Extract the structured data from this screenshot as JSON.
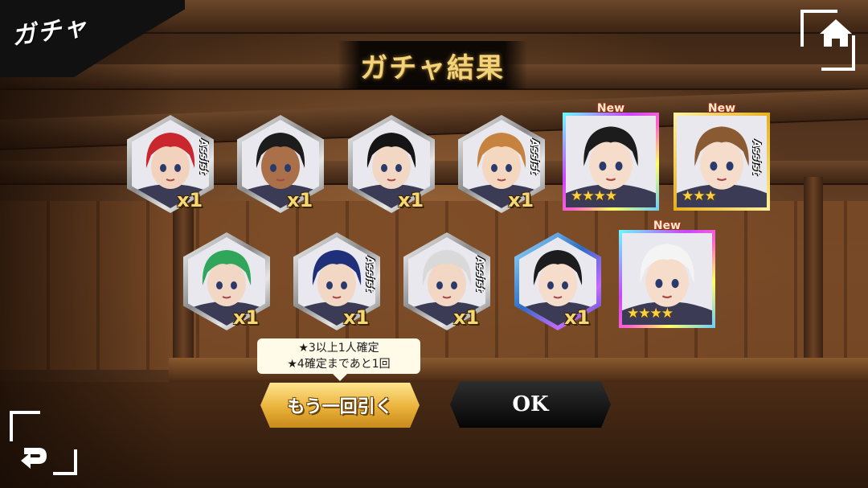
{
  "screen_name": "ガチャ",
  "title": "ガチャ結果",
  "assist_label": "Assist",
  "new_label": "New",
  "row1": [
    {
      "kind": "hex",
      "frame": "silver",
      "assist": true,
      "count": "x1",
      "hair": "#c9262d",
      "skin": "#f3d2bd"
    },
    {
      "kind": "hex",
      "frame": "silver",
      "assist": false,
      "count": "x1",
      "hair": "#1c1c1c",
      "skin": "#a9704a"
    },
    {
      "kind": "hex",
      "frame": "silver",
      "assist": false,
      "count": "x1",
      "hair": "#151515",
      "skin": "#f3d7c5"
    },
    {
      "kind": "hex",
      "frame": "silver",
      "assist": true,
      "count": "x1",
      "hair": "#c6823f",
      "skin": "#f5d7bf"
    },
    {
      "kind": "rect",
      "frame": "rainbow",
      "new": true,
      "assist": false,
      "stars": "★★★★",
      "hair": "#1c1c1c",
      "skin": "#f5dccb"
    },
    {
      "kind": "rect",
      "frame": "gold",
      "new": true,
      "assist": true,
      "stars": "★★★",
      "hair": "#8a5a32",
      "skin": "#f5dccb"
    }
  ],
  "row2": [
    {
      "kind": "hex",
      "frame": "silver",
      "assist": false,
      "count": "x1",
      "hair": "#2fa65a",
      "skin": "#f3d7c5"
    },
    {
      "kind": "hex",
      "frame": "silver",
      "assist": true,
      "count": "x1",
      "hair": "#1f2f7a",
      "skin": "#f3d7c5"
    },
    {
      "kind": "hex",
      "frame": "silver",
      "assist": true,
      "count": "x1",
      "hair": "#d9d9d9",
      "skin": "#f3d7c5"
    },
    {
      "kind": "hex",
      "frame": "blue",
      "assist": false,
      "count": "x1",
      "hair": "#1c1c1c",
      "skin": "#f5dccb"
    },
    {
      "kind": "rect",
      "frame": "rainbow",
      "new": true,
      "assist": false,
      "stars": "★★★★",
      "hair": "#f4f4f4",
      "skin": "#f5dccb"
    }
  ],
  "tooltip": {
    "line1": "★3以上1人確定",
    "line2": "★4確定まであと1回"
  },
  "buttons": {
    "again": "もう一回引く",
    "ok": "OK"
  },
  "icons": {
    "home": "home-icon",
    "back": "return-arrow-icon"
  }
}
